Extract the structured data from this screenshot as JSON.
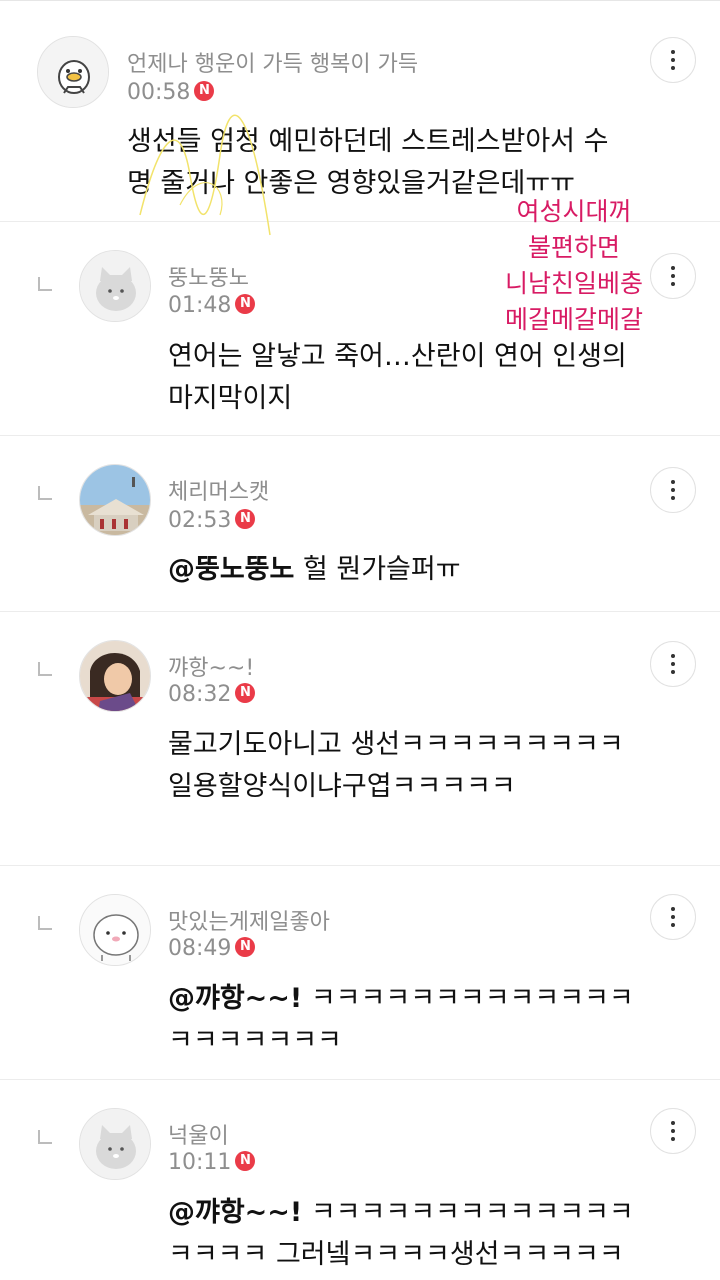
{
  "comments": [
    {
      "name": "언제나 행운이 가득 행복이 가득",
      "time": "00:58",
      "badge": "N",
      "text": "생선들 엄청 예민하던데 스트레스받아서 수명 줄거나 안좋은 영향있을거같은데ㅠㅠ",
      "avatar": "duck-avatar"
    },
    {
      "name": "뚱노뚱노",
      "time": "01:48",
      "badge": "N",
      "text": "연어는 알낳고 죽어…산란이 연어 인생의 마지막이지",
      "avatar": "cat-avatar"
    },
    {
      "name": "체리머스캣",
      "time": "02:53",
      "badge": "N",
      "mention": "@뚱노뚱노",
      "text": " 헐 뭔가슬퍼ㅠ",
      "avatar": "photo-avatar-building"
    },
    {
      "name": "꺄항~~!",
      "time": "08:32",
      "badge": "N",
      "text": "물고기도아니고 생선ㅋㅋㅋㅋㅋㅋㅋㅋㅋ일용할양식이냐구엽ㅋㅋㅋㅋㅋ",
      "avatar": "photo-avatar-person"
    },
    {
      "name": "맛있는게제일좋아",
      "time": "08:49",
      "badge": "N",
      "mention": "@꺄항~~!",
      "text": " ㅋㅋㅋㅋㅋㅋㅋㅋㅋㅋㅋㅋㅋㅋㅋㅋㅋㅋㅋㅋ",
      "avatar": "blob-avatar"
    },
    {
      "name": "넉울이",
      "time": "10:11",
      "badge": "N",
      "mention": "@꺄항~~!",
      "text": " ㅋㅋㅋㅋㅋㅋㅋㅋㅋㅋㅋㅋㅋㅋㅋㅋㅋ 그러넼ㅋㅋㅋㅋ생선ㅋㅋㅋㅋㅋ",
      "avatar": "cat-avatar"
    }
  ],
  "annotation": {
    "lines": [
      "여성시대꺼",
      "불편하면",
      "니남친일베충",
      "메갈메갈메갈"
    ],
    "color": "#d81b64"
  },
  "colors": {
    "badge": "#ea3b48",
    "meta": "#8e8e8e"
  }
}
